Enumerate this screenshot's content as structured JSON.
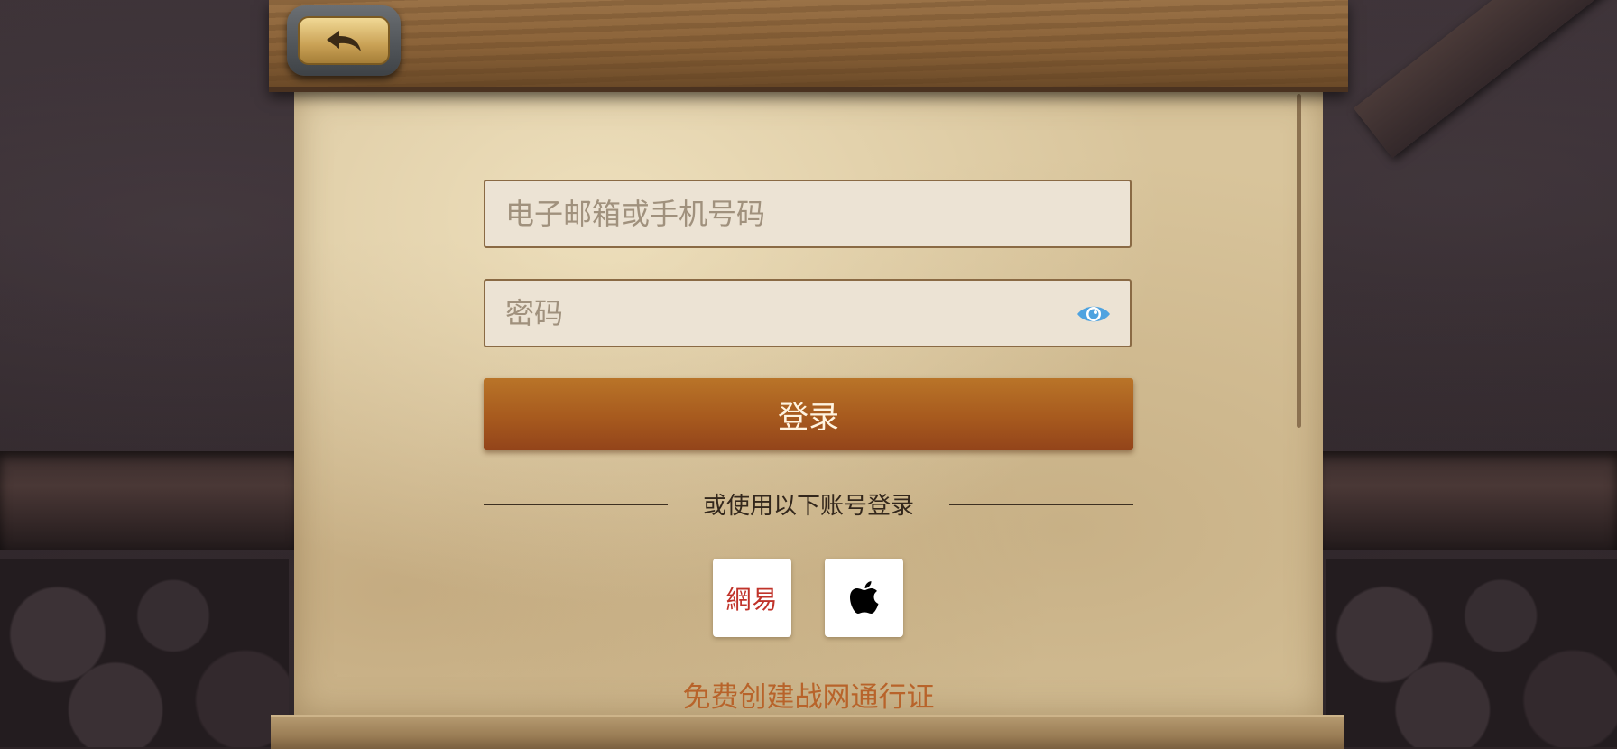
{
  "form": {
    "email_placeholder": "电子邮箱或手机号码",
    "password_placeholder": "密码",
    "login_label": "登录"
  },
  "alt_login": {
    "label": "或使用以下账号登录",
    "providers": [
      {
        "name": "netease",
        "label": "網易",
        "icon": "netease-logo"
      },
      {
        "name": "apple",
        "icon": "apple-icon"
      }
    ]
  },
  "create_account_label": "免费创建战网通行证",
  "icons": {
    "back": "back-arrow-icon",
    "password_toggle": "eye-icon"
  },
  "colors": {
    "login_button": "#a75a1e",
    "create_link": "#b8632a",
    "eye_icon": "#4fa3e0",
    "netease_red": "#c0332a"
  }
}
